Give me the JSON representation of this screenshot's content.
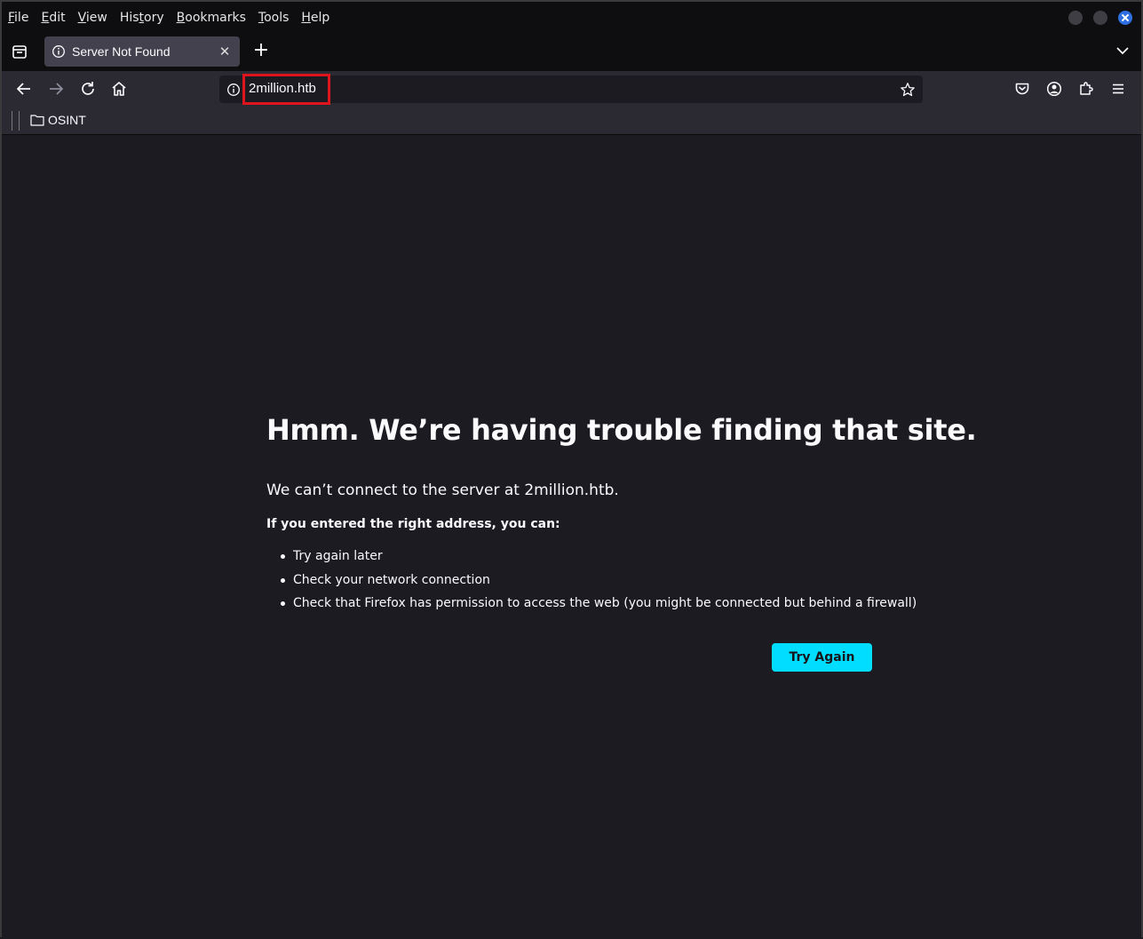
{
  "menubar": {
    "items": [
      {
        "first": "F",
        "rest": "ile"
      },
      {
        "first": "E",
        "rest": "dit"
      },
      {
        "first": "V",
        "rest": "iew"
      },
      {
        "first": "His",
        "u": "t",
        "rest": "ory"
      },
      {
        "first": "B",
        "rest": "ookmarks"
      },
      {
        "first": "T",
        "rest": "ools"
      },
      {
        "first": "H",
        "rest": "elp"
      }
    ]
  },
  "tab": {
    "title": "Server Not Found",
    "close_glyph": "✕"
  },
  "newtab_glyph": "+",
  "urlbar": {
    "url": "2million.htb"
  },
  "bookmarks": {
    "folder_label": "OSINT"
  },
  "error": {
    "title": "Hmm. We’re having trouble finding that site.",
    "description": "We can’t connect to the server at 2million.htb.",
    "subtitle": "If you entered the right address, you can:",
    "suggestions": [
      "Try again later",
      "Check your network connection",
      "Check that Firefox has permission to access the web (you might be connected but behind a firewall)"
    ],
    "button_label": "Try Again"
  },
  "colors": {
    "accent": "#00ddff",
    "highlight_box": "#e0141c",
    "background": "#1c1b22",
    "toolbar": "#2b2a33"
  }
}
